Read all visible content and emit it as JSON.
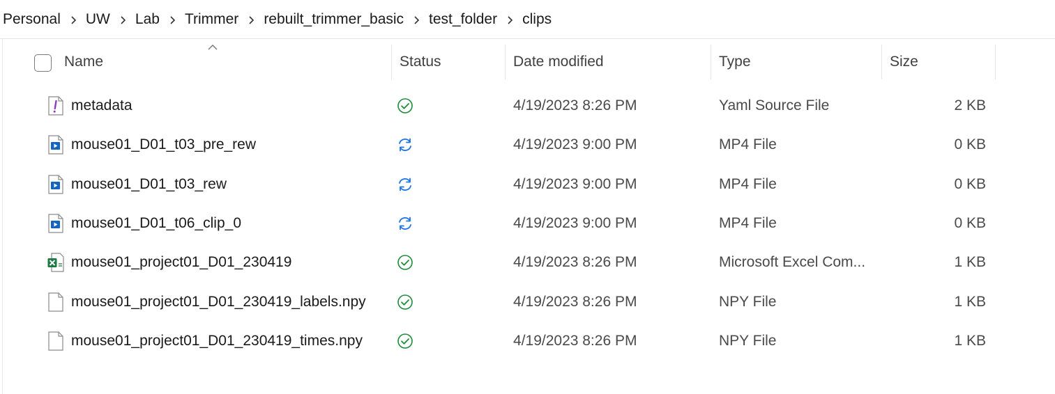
{
  "breadcrumb": [
    "Personal",
    "UW",
    "Lab",
    "Trimmer",
    "rebuilt_trimmer_basic",
    "test_folder",
    "clips"
  ],
  "columns": {
    "name": "Name",
    "status": "Status",
    "date": "Date modified",
    "type": "Type",
    "size": "Size"
  },
  "files": [
    {
      "name": "metadata",
      "icon": "yaml-file-icon",
      "status": "synced",
      "date": "4/19/2023 8:26 PM",
      "type": "Yaml Source File",
      "size": "2 KB"
    },
    {
      "name": "mouse01_D01_t03_pre_rew",
      "icon": "video-file-icon",
      "status": "syncing",
      "date": "4/19/2023 9:00 PM",
      "type": "MP4 File",
      "size": "0 KB"
    },
    {
      "name": "mouse01_D01_t03_rew",
      "icon": "video-file-icon",
      "status": "syncing",
      "date": "4/19/2023 9:00 PM",
      "type": "MP4 File",
      "size": "0 KB"
    },
    {
      "name": "mouse01_D01_t06_clip_0",
      "icon": "video-file-icon",
      "status": "syncing",
      "date": "4/19/2023 9:00 PM",
      "type": "MP4 File",
      "size": "0 KB"
    },
    {
      "name": "mouse01_project01_D01_230419",
      "icon": "excel-file-icon",
      "status": "synced",
      "date": "4/19/2023 8:26 PM",
      "type": "Microsoft Excel Com...",
      "size": "1 KB"
    },
    {
      "name": "mouse01_project01_D01_230419_labels.npy",
      "icon": "blank-file-icon",
      "status": "synced",
      "date": "4/19/2023 8:26 PM",
      "type": "NPY File",
      "size": "1 KB"
    },
    {
      "name": "mouse01_project01_D01_230419_times.npy",
      "icon": "blank-file-icon",
      "status": "synced",
      "date": "4/19/2023 8:26 PM",
      "type": "NPY File",
      "size": "1 KB"
    }
  ],
  "colors": {
    "synced": "#1e8c3a",
    "syncing": "#1a73e8",
    "yaml": "#8a3cc0",
    "video": "#1565c0",
    "excel": "#1d7a42"
  }
}
